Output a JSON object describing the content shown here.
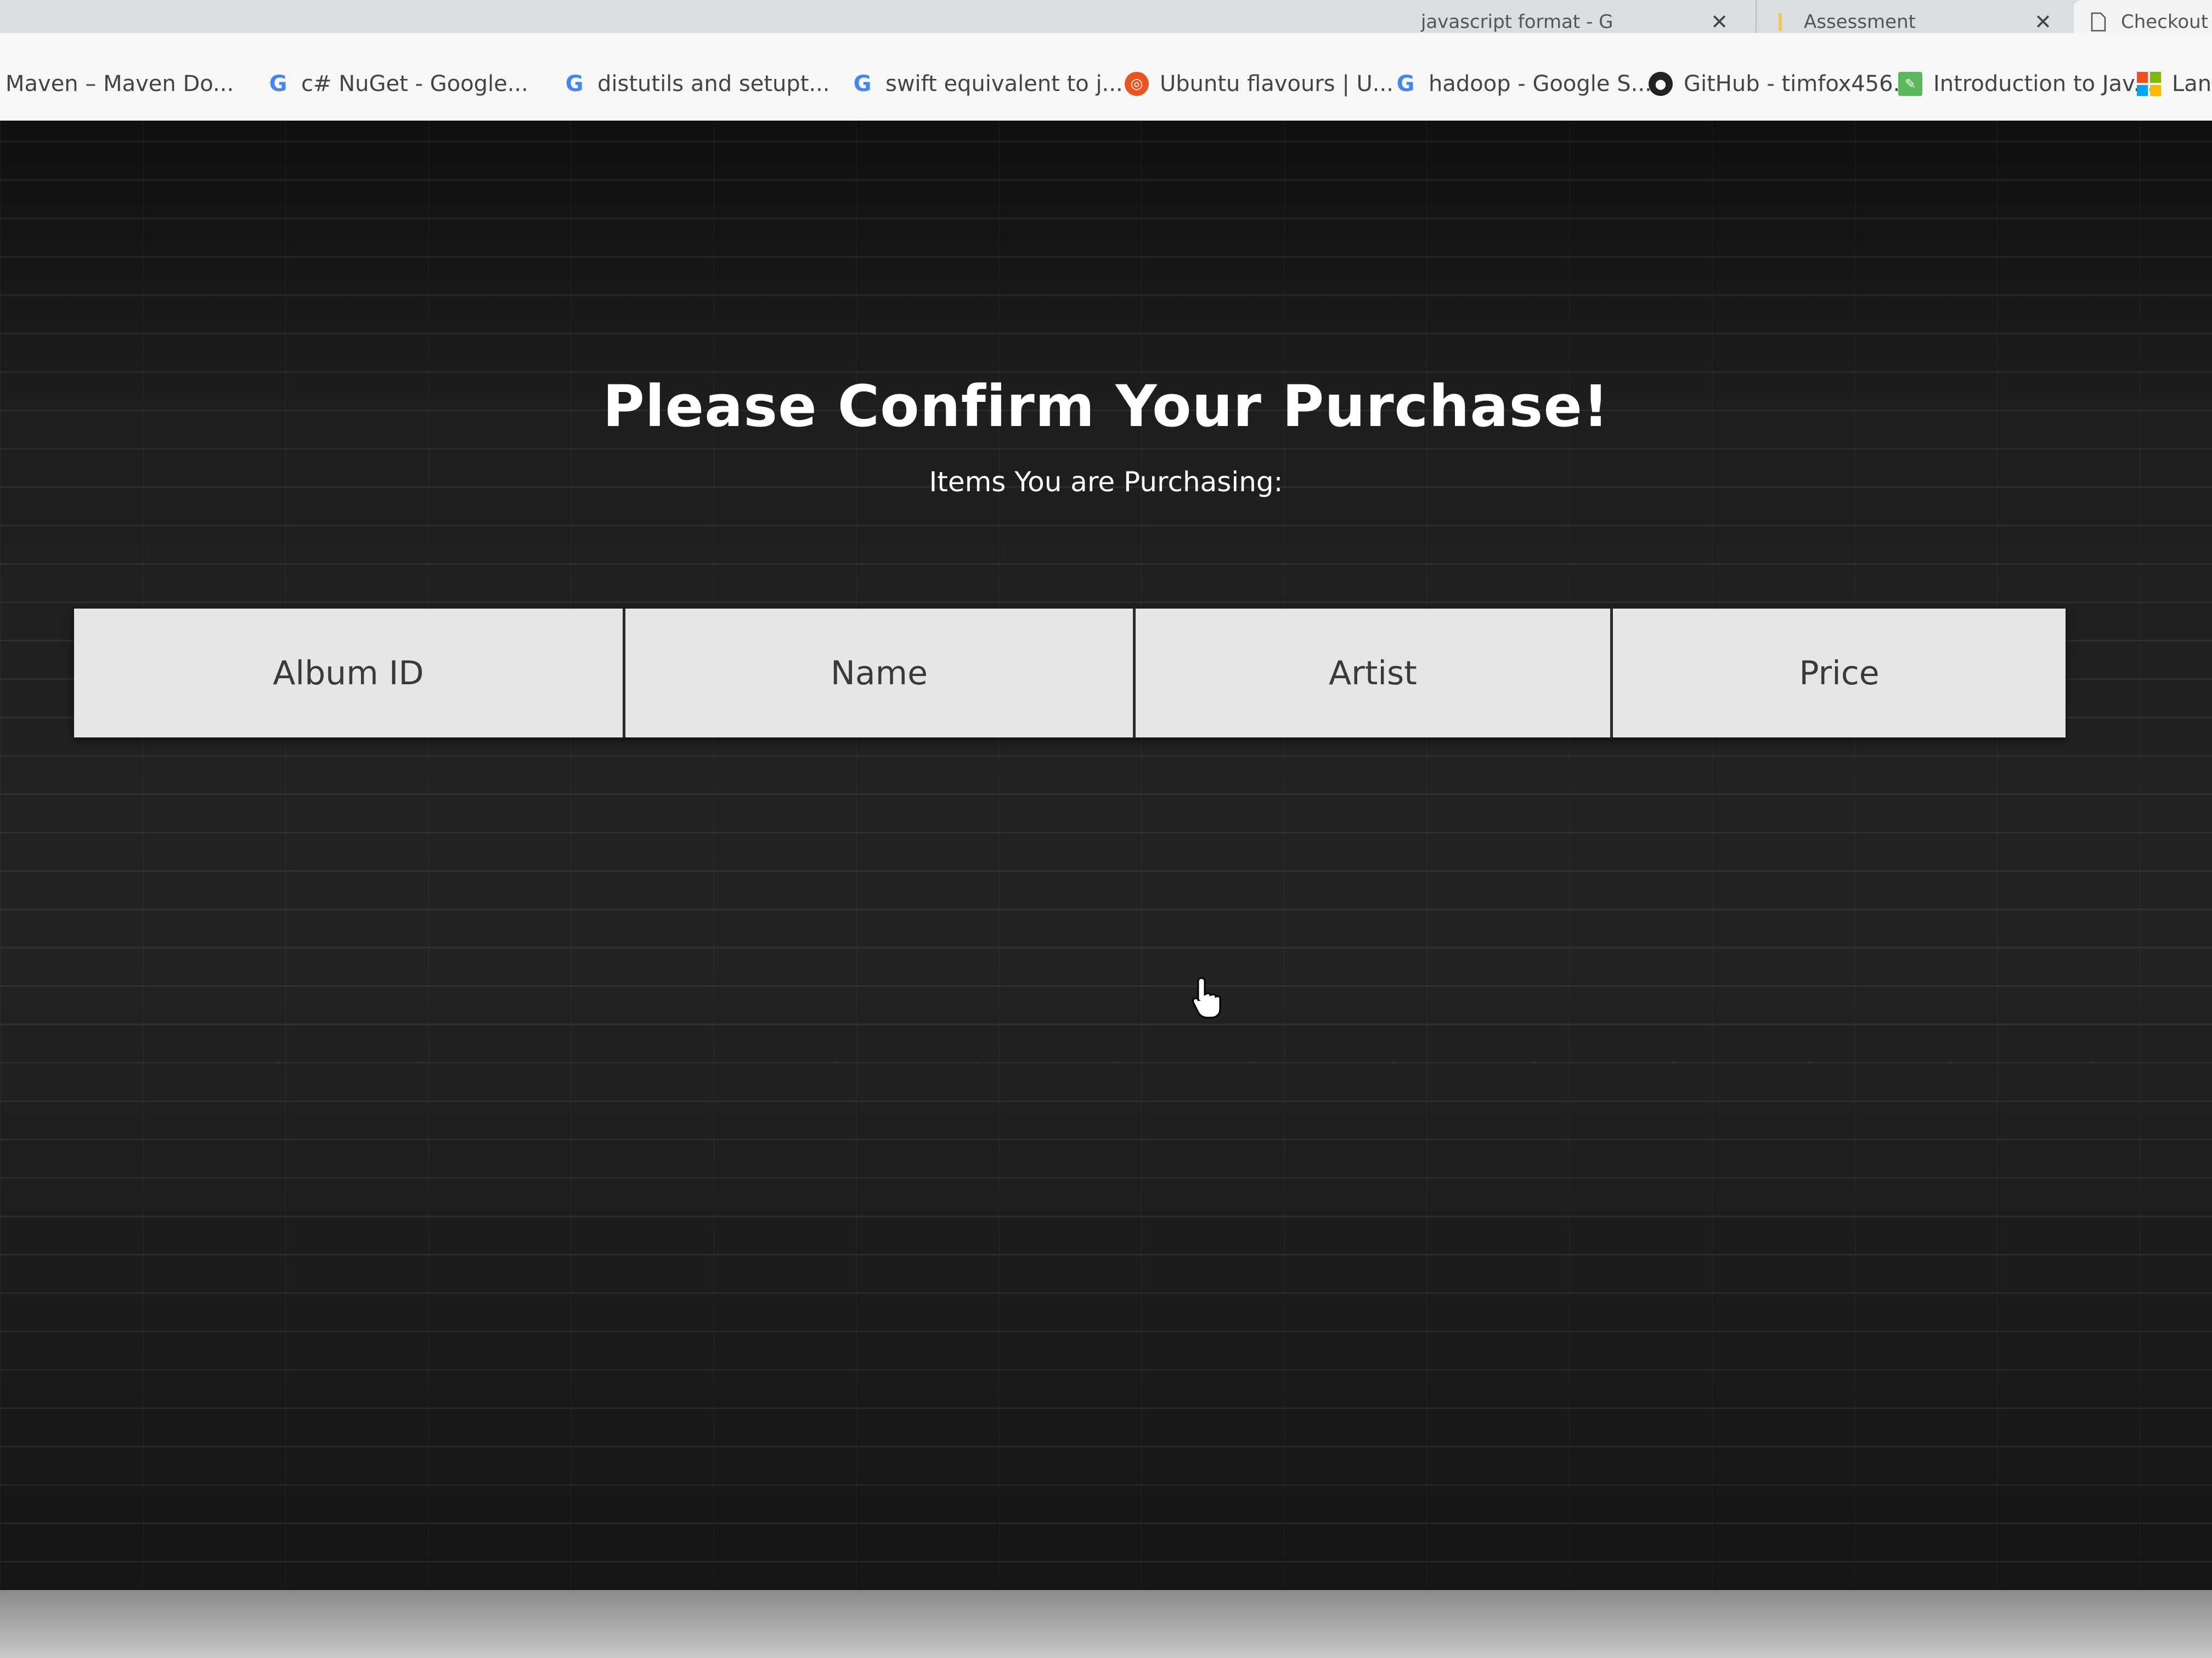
{
  "browser": {
    "tabs": [
      {
        "label": "javascript format - G",
        "icon": "google-icon"
      },
      {
        "label": "Assessment",
        "icon": "page-icon"
      },
      {
        "label": "Checkout",
        "icon": "document-icon"
      }
    ],
    "bookmarks": [
      {
        "label": "Maven – Maven Do...",
        "icon": "none"
      },
      {
        "label": "c# NuGet - Google...",
        "icon": "google-icon"
      },
      {
        "label": "distutils and setupt...",
        "icon": "google-icon"
      },
      {
        "label": "swift equivalent to j...",
        "icon": "google-icon"
      },
      {
        "label": "Ubuntu flavours | U...",
        "icon": "ubuntu-icon"
      },
      {
        "label": "hadoop - Google S...",
        "icon": "google-icon"
      },
      {
        "label": "GitHub - timfox456...",
        "icon": "github-icon"
      },
      {
        "label": "Introduction to Jav...",
        "icon": "leaf-icon"
      },
      {
        "label": "Lang",
        "icon": "microsoft-icon"
      }
    ]
  },
  "page": {
    "title": "Please Confirm Your Purchase!",
    "subtitle": "Items You are Purchasing:",
    "table": {
      "headers": [
        "Album ID",
        "Name",
        "Artist",
        "Price"
      ]
    }
  },
  "colors": {
    "background": "#1e1e1e",
    "header_bg": "#e6e6e6",
    "header_text": "#3a3a3a",
    "title_text": "#ffffff"
  }
}
